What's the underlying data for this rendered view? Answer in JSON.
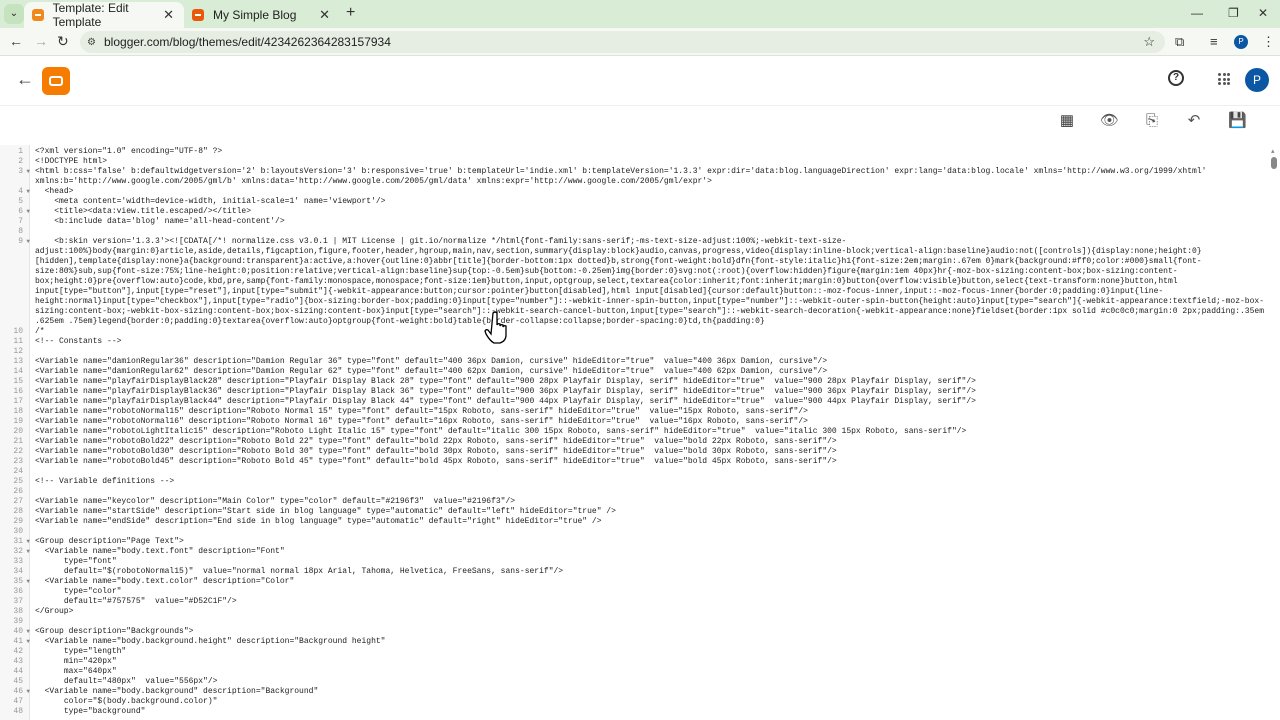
{
  "browser": {
    "tabs": [
      {
        "title": "Template: Edit Template",
        "active": true
      },
      {
        "title": "My Simple Blog",
        "active": false
      }
    ],
    "url": "blogger.com/blog/themes/edit/4234262364283157934",
    "profile_initial": "P"
  },
  "app": {
    "avatar_initial": "P",
    "help_icon": "?",
    "toolbar": [
      "layout-icon",
      "preview-icon",
      "revert-icon",
      "undo-icon",
      "save-icon"
    ]
  },
  "accent": "#f57c00",
  "editor": {
    "lines": [
      {
        "n": "1",
        "text": "<?xml version=\"1.0\" encoding=\"UTF-8\" ?>"
      },
      {
        "n": "2",
        "text": "<!DOCTYPE html>"
      },
      {
        "n": "3",
        "fold": true,
        "text": "<html b:css='false' b:defaultwidgetversion='2' b:layoutsVersion='3' b:responsive='true' b:templateUrl='indie.xml' b:templateVersion='1.3.3' expr:dir='data:blog.languageDirection' expr:lang='data:blog.locale' xmlns='http://www.w3.org/1999/xhtml' xmlns:b='http://www.google.com/2005/gml/b' xmlns:data='http://www.google.com/2005/gml/data' xmlns:expr='http://www.google.com/2005/gml/expr'>"
      },
      {
        "n": "4",
        "fold": true,
        "text": "  <head>"
      },
      {
        "n": "5",
        "text": "    <meta content='width=device-width, initial-scale=1' name='viewport'/>"
      },
      {
        "n": "6",
        "fold": true,
        "text": "    <title><data:view.title.escaped/></title>"
      },
      {
        "n": "7",
        "text": "    <b:include data='blog' name='all-head-content'/>"
      },
      {
        "n": "8",
        "text": ""
      },
      {
        "n": "9",
        "fold": true,
        "text": "    <b:skin version='1.3.3'><![CDATA[/*! normalize.css v3.0.1 | MIT License | git.io/normalize */html{font-family:sans-serif;-ms-text-size-adjust:100%;-webkit-text-size-adjust:100%}body{margin:0}article,aside,details,figcaption,figure,footer,header,hgroup,main,nav,section,summary{display:block}audio,canvas,progress,video{display:inline-block;vertical-align:baseline}audio:not([controls]){display:none;height:0} [hidden],template{display:none}a{background:transparent}a:active,a:hover{outline:0}abbr[title]{border-bottom:1px dotted}b,strong{font-weight:bold}dfn{font-style:italic}h1{font-size:2em;margin:.67em 0}mark{background:#ff0;color:#000}small{font-size:80%}sub,sup{font-size:75%;line-height:0;position:relative;vertical-align:baseline}sup{top:-0.5em}sub{bottom:-0.25em}img{border:0}svg:not(:root){overflow:hidden}figure{margin:1em 40px}hr{-moz-box-sizing:content-box;box-sizing:content-box;height:0}pre{overflow:auto}code,kbd,pre,samp{font-family:monospace,monospace;font-size:1em}button,input,optgroup,select,textarea{color:inherit;font:inherit;margin:0}button{overflow:visible}button,select{text-transform:none}button,html input[type=\"button\"],input[type=\"reset\"],input[type=\"submit\"]{-webkit-appearance:button;cursor:pointer}button[disabled],html input[disabled]{cursor:default}button::-moz-focus-inner,input::-moz-focus-inner{border:0;padding:0}input{line-height:normal}input[type=\"checkbox\"],input[type=\"radio\"]{box-sizing:border-box;padding:0}input[type=\"number\"]::-webkit-inner-spin-button,input[type=\"number\"]::-webkit-outer-spin-button{height:auto}input[type=\"search\"]{-webkit-appearance:textfield;-moz-box-sizing:content-box;-webkit-box-sizing:content-box;box-sizing:content-box}input[type=\"search\"]::-webkit-search-cancel-button,input[type=\"search\"]::-webkit-search-decoration{-webkit-appearance:none}fieldset{border:1px solid #c0c0c0;margin:0 2px;padding:.35em .625em .75em}legend{border:0;padding:0}textarea{overflow:auto}optgroup{font-weight:bold}table{border-collapse:collapse;border-spacing:0}td,th{padding:0}"
      },
      {
        "n": "10",
        "text": "/*"
      },
      {
        "n": "11",
        "text": "<!-- Constants -->"
      },
      {
        "n": "12",
        "text": ""
      },
      {
        "n": "13",
        "text": "<Variable name=\"damionRegular36\" description=\"Damion Regular 36\" type=\"font\" default=\"400 36px Damion, cursive\" hideEditor=\"true\"  value=\"400 36px Damion, cursive\"/>"
      },
      {
        "n": "14",
        "text": "<Variable name=\"damionRegular62\" description=\"Damion Regular 62\" type=\"font\" default=\"400 62px Damion, cursive\" hideEditor=\"true\"  value=\"400 62px Damion, cursive\"/>"
      },
      {
        "n": "15",
        "text": "<Variable name=\"playfairDisplayBlack28\" description=\"Playfair Display Black 28\" type=\"font\" default=\"900 28px Playfair Display, serif\" hideEditor=\"true\"  value=\"900 28px Playfair Display, serif\"/>"
      },
      {
        "n": "16",
        "text": "<Variable name=\"playfairDisplayBlack36\" description=\"Playfair Display Black 36\" type=\"font\" default=\"900 36px Playfair Display, serif\" hideEditor=\"true\"  value=\"900 36px Playfair Display, serif\"/>"
      },
      {
        "n": "17",
        "text": "<Variable name=\"playfairDisplayBlack44\" description=\"Playfair Display Black 44\" type=\"font\" default=\"900 44px Playfair Display, serif\" hideEditor=\"true\"  value=\"900 44px Playfair Display, serif\"/>"
      },
      {
        "n": "18",
        "text": "<Variable name=\"robotoNormal15\" description=\"Roboto Normal 15\" type=\"font\" default=\"15px Roboto, sans-serif\" hideEditor=\"true\"  value=\"15px Roboto, sans-serif\"/>"
      },
      {
        "n": "19",
        "text": "<Variable name=\"robotoNormal16\" description=\"Roboto Normal 16\" type=\"font\" default=\"16px Roboto, sans-serif\" hideEditor=\"true\"  value=\"16px Roboto, sans-serif\"/>"
      },
      {
        "n": "20",
        "text": "<Variable name=\"robotoLightItalic15\" description=\"Roboto Light Italic 15\" type=\"font\" default=\"italic 300 15px Roboto, sans-serif\" hideEditor=\"true\"  value=\"italic 300 15px Roboto, sans-serif\"/>"
      },
      {
        "n": "21",
        "text": "<Variable name=\"robotoBold22\" description=\"Roboto Bold 22\" type=\"font\" default=\"bold 22px Roboto, sans-serif\" hideEditor=\"true\"  value=\"bold 22px Roboto, sans-serif\"/>"
      },
      {
        "n": "22",
        "text": "<Variable name=\"robotoBold30\" description=\"Roboto Bold 30\" type=\"font\" default=\"bold 30px Roboto, sans-serif\" hideEditor=\"true\"  value=\"bold 30px Roboto, sans-serif\"/>"
      },
      {
        "n": "23",
        "text": "<Variable name=\"robotoBold45\" description=\"Roboto Bold 45\" type=\"font\" default=\"bold 45px Roboto, sans-serif\" hideEditor=\"true\"  value=\"bold 45px Roboto, sans-serif\"/>"
      },
      {
        "n": "24",
        "text": ""
      },
      {
        "n": "25",
        "text": "<!-- Variable definitions -->"
      },
      {
        "n": "26",
        "text": ""
      },
      {
        "n": "27",
        "text": "<Variable name=\"keycolor\" description=\"Main Color\" type=\"color\" default=\"#2196f3\"  value=\"#2196f3\"/>"
      },
      {
        "n": "28",
        "text": "<Variable name=\"startSide\" description=\"Start side in blog language\" type=\"automatic\" default=\"left\" hideEditor=\"true\" />"
      },
      {
        "n": "29",
        "text": "<Variable name=\"endSide\" description=\"End side in blog language\" type=\"automatic\" default=\"right\" hideEditor=\"true\" />"
      },
      {
        "n": "30",
        "text": ""
      },
      {
        "n": "31",
        "fold": true,
        "text": "<Group description=\"Page Text\">"
      },
      {
        "n": "32",
        "fold": true,
        "text": "  <Variable name=\"body.text.font\" description=\"Font\""
      },
      {
        "n": "33",
        "text": "      type=\"font\""
      },
      {
        "n": "34",
        "text": "      default=\"$(robotoNormal15)\"  value=\"normal normal 18px Arial, Tahoma, Helvetica, FreeSans, sans-serif\"/>"
      },
      {
        "n": "35",
        "fold": true,
        "text": "  <Variable name=\"body.text.color\" description=\"Color\""
      },
      {
        "n": "36",
        "text": "      type=\"color\""
      },
      {
        "n": "37",
        "text": "      default=\"#757575\"  value=\"#D52C1F\"/>"
      },
      {
        "n": "38",
        "text": "</Group>"
      },
      {
        "n": "39",
        "text": ""
      },
      {
        "n": "40",
        "fold": true,
        "text": "<Group description=\"Backgrounds\">"
      },
      {
        "n": "41",
        "fold": true,
        "text": "  <Variable name=\"body.background.height\" description=\"Background height\""
      },
      {
        "n": "42",
        "text": "      type=\"length\""
      },
      {
        "n": "43",
        "text": "      min=\"420px\""
      },
      {
        "n": "44",
        "text": "      max=\"640px\""
      },
      {
        "n": "45",
        "text": "      default=\"480px\"  value=\"556px\"/>"
      },
      {
        "n": "46",
        "fold": true,
        "text": "  <Variable name=\"body.background\" description=\"Background\""
      },
      {
        "n": "47",
        "text": "      color=\"$(body.background.color)\""
      },
      {
        "n": "48",
        "text": "      type=\"background\""
      }
    ]
  }
}
